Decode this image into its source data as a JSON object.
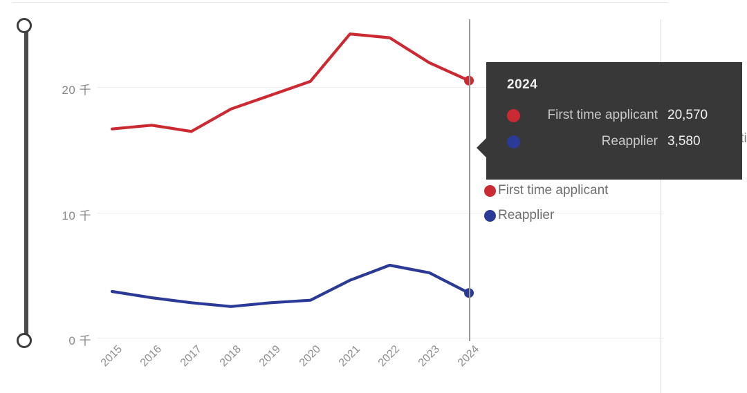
{
  "chart_data": {
    "type": "line",
    "title": "",
    "xlabel": "",
    "ylabel": "",
    "categories": [
      "2015",
      "2016",
      "2017",
      "2018",
      "2019",
      "2020",
      "2021",
      "2022",
      "2023",
      "2024"
    ],
    "series": [
      {
        "name": "First time applicant",
        "color": "#cc2a33",
        "values": [
          16700,
          17000,
          16500,
          18300,
          19400,
          20500,
          24300,
          24000,
          22000,
          20570
        ]
      },
      {
        "name": "Reapplier",
        "color": "#2b3a96",
        "values": [
          3700,
          3200,
          2800,
          2500,
          2800,
          3000,
          4600,
          5800,
          5200,
          3580
        ]
      }
    ],
    "ylim": [
      0,
      27000
    ],
    "yticks": [
      {
        "value": 0,
        "label": "0 千"
      },
      {
        "value": 10000,
        "label": "10 千"
      },
      {
        "value": 20000,
        "label": "20 千"
      }
    ],
    "grid": true,
    "legend_position": "right",
    "highlighted_x": "2024"
  },
  "yaxis": {
    "tick0": "0 千",
    "tick1": "10 千",
    "tick2": "20 千"
  },
  "xaxis": {
    "labels": [
      "2015",
      "2016",
      "2017",
      "2018",
      "2019",
      "2020",
      "2021",
      "2022",
      "2023",
      "2024"
    ]
  },
  "legend": {
    "items": [
      {
        "label": "First time applicant",
        "color": "#cc2a33"
      },
      {
        "label": "Reapplier",
        "color": "#2b3a96"
      }
    ],
    "ghost_label": "First tim"
  },
  "tooltip": {
    "title": "2024",
    "rows": [
      {
        "name": "First time applicant",
        "value": "20,570",
        "color": "#cc2a33"
      },
      {
        "name": "Reapplier",
        "value": "3,580",
        "color": "#2b3a96"
      }
    ]
  },
  "range_slider": {
    "top_handle": "range-slider-top-handle",
    "bottom_handle": "range-slider-bottom-handle"
  },
  "colors": {
    "first_time_applicant": "#cc2a33",
    "reapplier": "#2b3a96",
    "tooltip_bg": "#383838",
    "grid": "#ededed",
    "axis_text": "#8a8a8a"
  }
}
